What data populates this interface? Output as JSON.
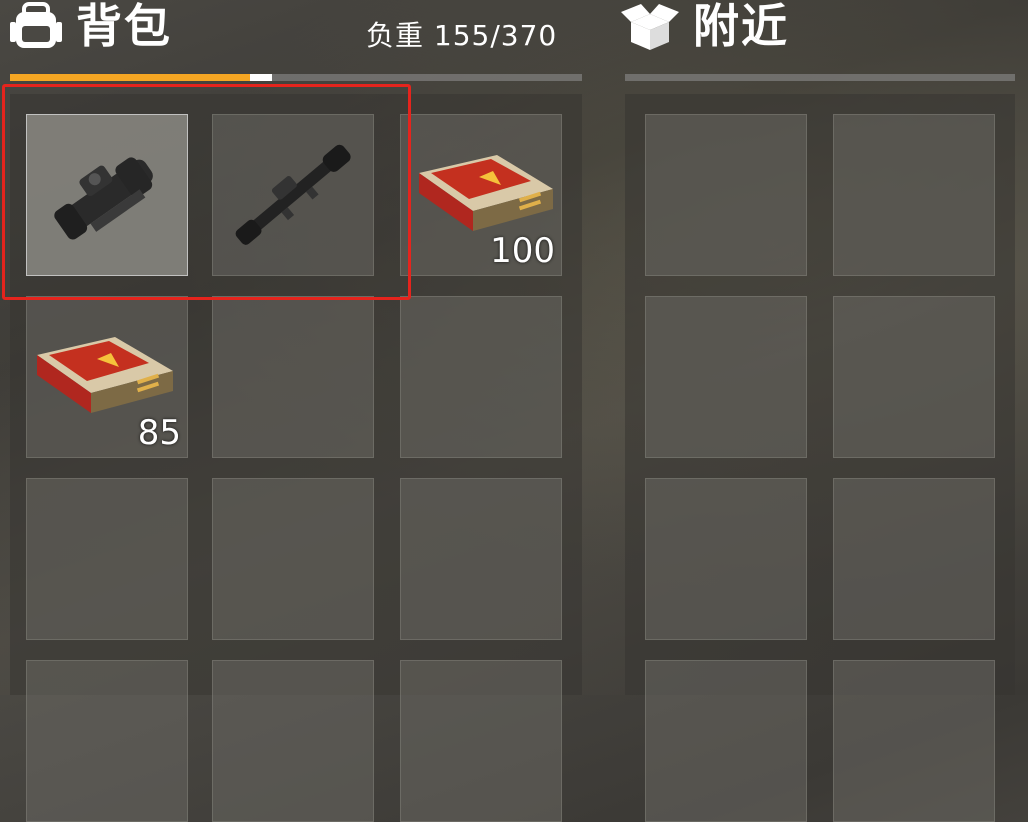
{
  "bag": {
    "title": "背包",
    "icon": "backpack-icon",
    "weight_label": "负重",
    "weight_value": "155/370",
    "weight_fraction": 0.419,
    "slots": [
      {
        "item": "scope-icon",
        "count": "",
        "selected": true
      },
      {
        "item": "sniper-scope-icon",
        "count": "",
        "selected": false
      },
      {
        "item": "ammo-box-icon",
        "count": "100",
        "selected": false
      },
      {
        "item": "ammo-box-icon",
        "count": "85",
        "selected": false
      }
    ]
  },
  "nearby": {
    "title": "附近",
    "icon": "open-box-icon"
  },
  "colors": {
    "accent": "#f5a623",
    "highlight": "#e5241d"
  }
}
